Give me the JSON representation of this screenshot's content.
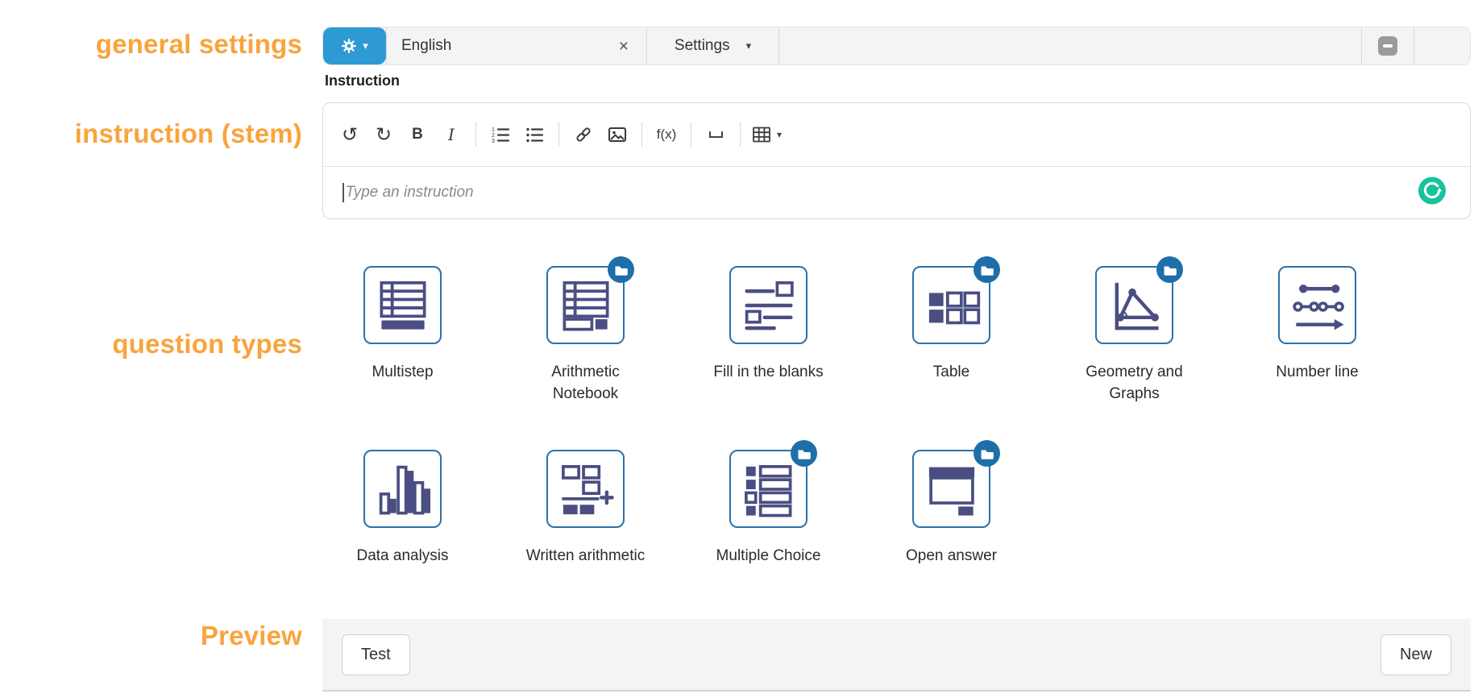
{
  "annotations": {
    "accent_color": "#F8A43D",
    "general_settings": "general settings",
    "instruction_stem": "instruction (stem)",
    "question_types": "question types",
    "preview": "Preview"
  },
  "header": {
    "gear_button": {
      "icon": "gear-icon",
      "caret": "▾",
      "color": "#2D9AD4"
    },
    "language_tab": {
      "label": "English",
      "close": "×"
    },
    "settings_tab": {
      "label": "Settings",
      "caret": "▾"
    },
    "collapse_button": {
      "icon": "dash-square-icon"
    }
  },
  "instruction": {
    "label": "Instruction",
    "placeholder": "Type an instruction",
    "toolbar": {
      "undo": "↺",
      "redo": "↻",
      "bold": "B",
      "italic": "I",
      "formula": "f(x)",
      "table_caret": "▾",
      "icons": [
        "undo",
        "redo",
        "bold",
        "italic",
        "ordered-list",
        "unordered-list",
        "link",
        "image",
        "formula",
        "blank",
        "table"
      ]
    },
    "grammarly_color": "#15C39A"
  },
  "question_types": {
    "style": {
      "tile_border": "#2D71A9",
      "icon_color": "#4A4E82",
      "badge_color": "#1E6FA9"
    },
    "tiles": [
      {
        "label": "Multistep",
        "badge": false
      },
      {
        "label": "Arithmetic Notebook",
        "badge": true
      },
      {
        "label": "Fill in the blanks",
        "badge": false
      },
      {
        "label": "Table",
        "badge": true
      },
      {
        "label": "Geometry and Graphs",
        "badge": true
      },
      {
        "label": "Number line",
        "badge": false
      },
      {
        "label": "Data analysis",
        "badge": false
      },
      {
        "label": "Written arithmetic",
        "badge": false
      },
      {
        "label": "Multiple Choice",
        "badge": true
      },
      {
        "label": "Open answer",
        "badge": true
      }
    ]
  },
  "preview_bar": {
    "test_button": "Test",
    "new_button": "New"
  }
}
